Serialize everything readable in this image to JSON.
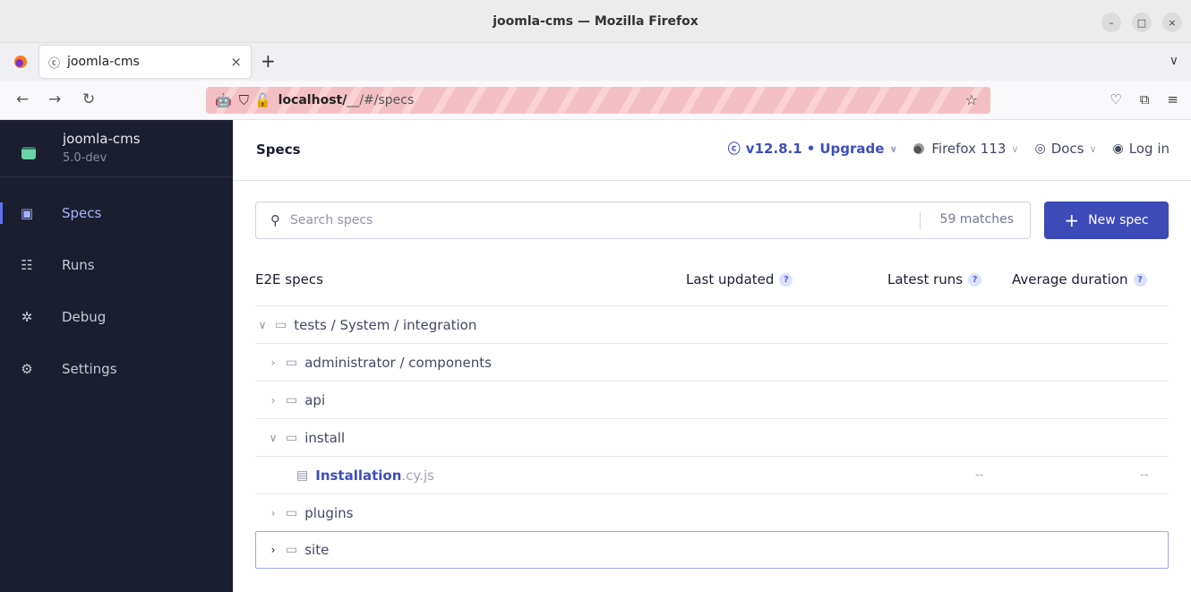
{
  "window": {
    "title": "joomla-cms — Mozilla Firefox",
    "controls": {
      "minimize": "–",
      "maximize": "□",
      "close": "×"
    }
  },
  "browser": {
    "tab": {
      "title": "joomla-cms",
      "close": "×"
    },
    "new_tab": "+",
    "tab_list": "∨",
    "url": {
      "host": "localhost/",
      "path": "__/#/specs"
    },
    "icons": [
      "back-icon",
      "forward-icon",
      "reload-icon",
      "robot-icon",
      "shield-icon",
      "lock-icon",
      "star-icon",
      "pocket-icon",
      "extensions-icon",
      "menu-icon"
    ]
  },
  "sidebar": {
    "project_name": "joomla-cms",
    "project_version": "5.0-dev",
    "items": [
      {
        "label": "Specs",
        "icon": "specs-icon",
        "active": true
      },
      {
        "label": "Runs",
        "icon": "runs-icon",
        "active": false
      },
      {
        "label": "Debug",
        "icon": "debug-icon",
        "active": false
      },
      {
        "label": "Settings",
        "icon": "settings-icon",
        "active": false
      }
    ]
  },
  "header": {
    "title": "Specs",
    "version": "v12.8.1",
    "upgrade": "Upgrade",
    "browser": "Firefox 113",
    "docs": "Docs",
    "login": "Log in"
  },
  "search": {
    "placeholder": "Search specs",
    "matches": "59 matches"
  },
  "new_spec_label": "New spec",
  "table": {
    "headers": {
      "name": "E2E specs",
      "last_updated": "Last updated",
      "latest_runs": "Latest runs",
      "average_duration": "Average duration",
      "help": "?"
    },
    "rows": [
      {
        "label": "tests / System / integration",
        "expanded": true,
        "level": 0
      },
      {
        "label": "administrator / components",
        "expanded": false,
        "level": 1
      },
      {
        "label": "api",
        "expanded": false,
        "level": 1
      },
      {
        "label": "install",
        "expanded": true,
        "level": 1
      },
      {
        "name": "Installation",
        "ext": ".cy.js",
        "last_updated": "--",
        "average_duration": "--",
        "level": 2
      },
      {
        "label": "plugins",
        "expanded": false,
        "level": 1
      },
      {
        "label": "site",
        "expanded": false,
        "level": 1
      }
    ]
  },
  "colors": {
    "sidebar_bg": "#1b1e2e",
    "accent": "#3d4bb8",
    "active_nav": "#a5b4fc",
    "url_bar_stripe": "#f4bfc4"
  }
}
